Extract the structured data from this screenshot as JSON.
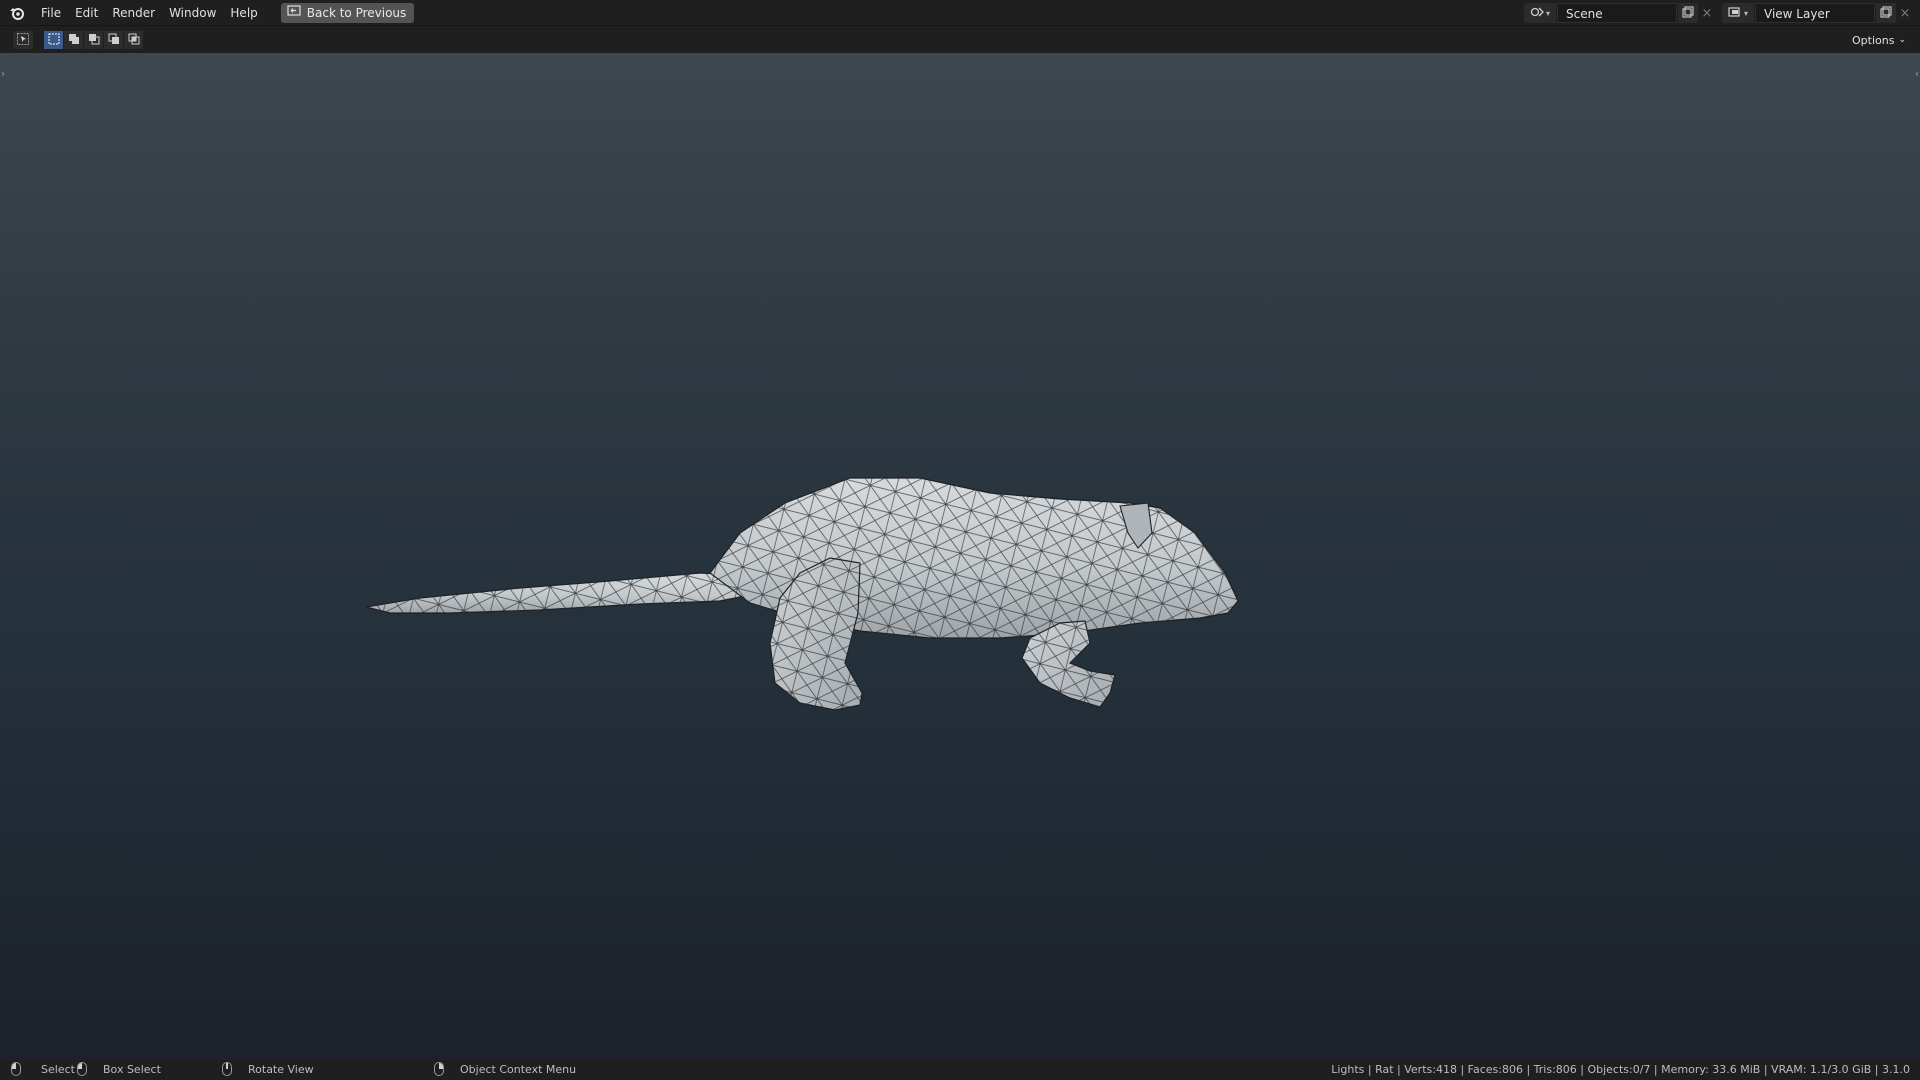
{
  "menu": {
    "items": [
      "File",
      "Edit",
      "Render",
      "Window",
      "Help"
    ],
    "back_button": "Back to Previous"
  },
  "scene": {
    "name": "Scene"
  },
  "view_layer": {
    "name": "View Layer"
  },
  "header": {
    "options_label": "Options"
  },
  "status": {
    "select": "Select",
    "box_select": "Box Select",
    "rotate_view": "Rotate View",
    "context_menu": "Object Context Menu",
    "stats": "Lights | Rat | Verts:418 | Faces:806 | Tris:806 | Objects:0/7 | Memory: 33.6 MiB | VRAM: 1.1/3.0 GiB | 3.1.0"
  },
  "colors": {
    "accent": "#3a5a8a",
    "viewport_top": "#3c474f",
    "viewport_bottom": "#1c212b",
    "mesh": "#c9cdd0"
  },
  "icons": {
    "app": "blender-logo-icon",
    "back": "screen-back-icon",
    "scene": "scene-icon",
    "view_layer": "view-layer-icon",
    "duplicate": "duplicate-icon",
    "close": "close-icon",
    "select_tool": "cursor-select-icon",
    "select_modes": [
      "select-new-icon",
      "select-extend-icon",
      "select-subtract-icon",
      "select-invert-icon",
      "select-intersect-icon"
    ]
  }
}
